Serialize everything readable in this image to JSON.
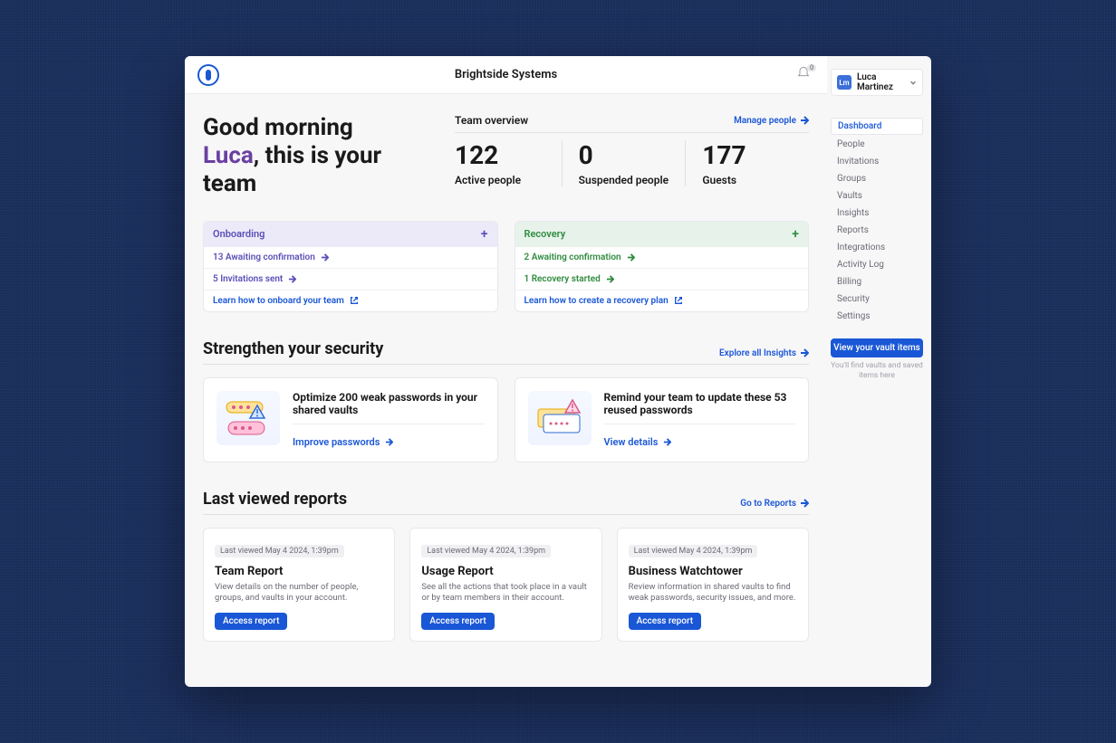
{
  "header": {
    "org_name": "Brightside Systems",
    "notification_count": "0"
  },
  "user": {
    "initials": "Lm",
    "name": "Luca Martinez"
  },
  "greeting": {
    "line1": "Good morning",
    "name": "Luca",
    "line2_suffix": ", this is your team"
  },
  "team_overview": {
    "title": "Team overview",
    "manage_link": "Manage people",
    "stats": [
      {
        "value": "122",
        "label": "Active people"
      },
      {
        "value": "0",
        "label": "Suspended people"
      },
      {
        "value": "177",
        "label": "Guests"
      }
    ]
  },
  "onboarding": {
    "title": "Onboarding",
    "items": [
      "13 Awaiting confirmation",
      "5 Invitations sent"
    ],
    "learn": "Learn how to onboard your team"
  },
  "recovery": {
    "title": "Recovery",
    "items": [
      "2 Awaiting confirmation",
      "1 Recovery started"
    ],
    "learn": "Learn how to create a recovery plan"
  },
  "security": {
    "title": "Strengthen your security",
    "explore_link": "Explore all Insights",
    "cards": [
      {
        "title": "Optimize 200 weak passwords in your shared vaults",
        "link": "Improve passwords"
      },
      {
        "title": "Remind your team to update these 53 reused passwords",
        "link": "View details"
      }
    ]
  },
  "reports": {
    "title": "Last viewed reports",
    "go_link": "Go to Reports",
    "cards": [
      {
        "tag": "Last viewed May 4 2024, 1:39pm",
        "title": "Team Report",
        "desc": "View details on the number of people, groups, and vaults in your account.",
        "btn": "Access report"
      },
      {
        "tag": "Last viewed May 4 2024, 1:39pm",
        "title": "Usage Report",
        "desc": "See all the actions that took place in a vault or by team members in their account.",
        "btn": "Access report"
      },
      {
        "tag": "Last viewed May 4 2024, 1:39pm",
        "title": "Business Watchtower",
        "desc": "Review information in shared vaults to find weak passwords, security issues, and more.",
        "btn": "Access report"
      }
    ]
  },
  "nav": {
    "items": [
      "Dashboard",
      "People",
      "Invitations",
      "Groups",
      "Vaults",
      "Insights",
      "Reports",
      "Integrations",
      "Activity Log",
      "Billing",
      "Security",
      "Settings"
    ],
    "active": "Dashboard"
  },
  "vault": {
    "button": "View your vault items",
    "hint": "You'll find vaults and saved items here"
  }
}
